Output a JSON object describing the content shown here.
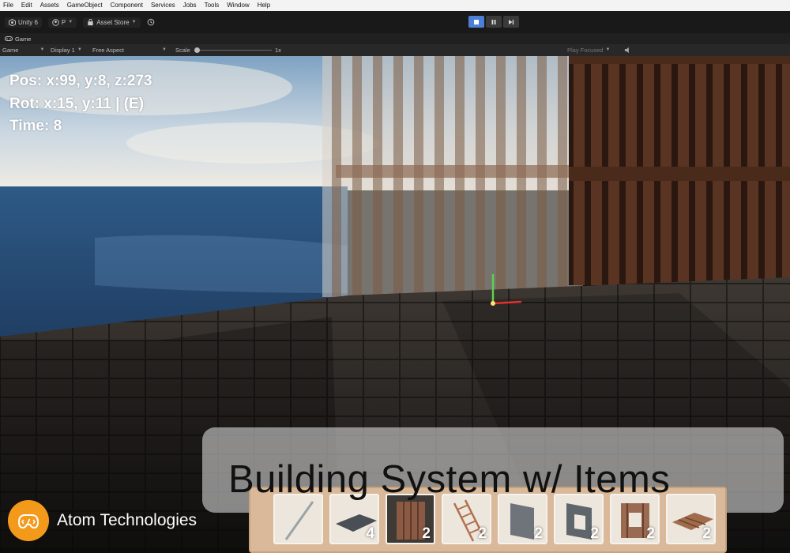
{
  "menu": [
    "File",
    "Edit",
    "Assets",
    "GameObject",
    "Component",
    "Services",
    "Jobs",
    "Tools",
    "Window",
    "Help"
  ],
  "toolbar": {
    "unity_label": "Unity 6",
    "account_label": "P",
    "asset_store_label": "Asset Store"
  },
  "tab": {
    "label": "Game"
  },
  "gamebar": {
    "mode": "Game",
    "display": "Display 1",
    "aspect": "Free Aspect",
    "scale_label": "Scale",
    "scale_value": "1x",
    "play_focused": "Play Focused"
  },
  "hud": {
    "pos": "Pos: x:99, y:8, z:273",
    "rot": "Rot: x:15, y:11 | (E)",
    "time": "Time: 8"
  },
  "banner": {
    "title": "Building System w/ Items"
  },
  "brand": {
    "name": "Atom Technologies",
    "logo_color": "#f49a1a"
  },
  "hotbar": {
    "slots": [
      {
        "item": "stick",
        "count": ""
      },
      {
        "item": "floor-tile",
        "count": "4"
      },
      {
        "item": "wood-wall",
        "count": "2"
      },
      {
        "item": "ladder",
        "count": "2"
      },
      {
        "item": "stone-wall",
        "count": "2"
      },
      {
        "item": "window-frame",
        "count": "2"
      },
      {
        "item": "wood-window",
        "count": "2"
      },
      {
        "item": "wood-plank",
        "count": "2"
      }
    ]
  }
}
